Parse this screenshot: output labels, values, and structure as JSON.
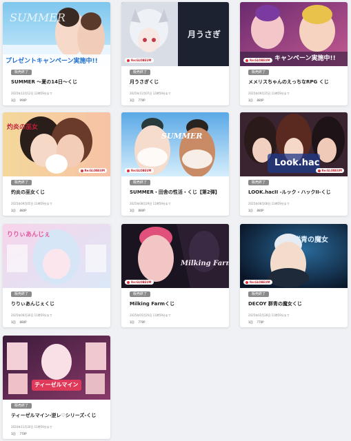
{
  "products": [
    {
      "title": "SUMMER 〜夏の14日〜くじ",
      "status": "販売終了",
      "deadline": "2025年12月12日 12時59分まで",
      "unit": "1回",
      "price": "990P",
      "banner_text": "プレゼントキャンペーン実施中!!"
    },
    {
      "title": "月うさぎくじ",
      "status": "販売終了",
      "deadline": "2025年11月07日 12時59分まで",
      "unit": "1回",
      "price": "770P",
      "banner_text": "月うさぎ"
    },
    {
      "title": "メメリスちゃんのえっちなRPG くじ",
      "status": "販売終了",
      "deadline": "2025年09月25日 11時59分まで",
      "unit": "1回",
      "price": "880P",
      "banner_text": "キャンペーン実施中!!"
    },
    {
      "title": "灼炎の巫女くじ",
      "status": "販売終了",
      "deadline": "2025年09月05日 11時59分まで",
      "unit": "1回",
      "price": "880P",
      "banner_text": "灼炎の巫女"
    },
    {
      "title": "SUMMER・田舎の性活・くじ【第2弾】",
      "status": "販売終了",
      "deadline": "2025年08月29日 11時59分まで",
      "unit": "1回",
      "price": "880P",
      "banner_text": "SUMMER"
    },
    {
      "title": "LOOK.hacII -ルック・ハックII-くじ",
      "status": "販売終了",
      "deadline": "2025年08月08日 11時59分まで",
      "unit": "1回",
      "price": "880P",
      "banner_text": "Look.hac"
    },
    {
      "title": "りりぃあんじぇくじ",
      "status": "販売終了",
      "deadline": "2025年06月30日 11時59分まで",
      "unit": "1回",
      "price": "880P",
      "banner_text": "りりぃあんじぇ"
    },
    {
      "title": "Milking Farmくじ",
      "status": "販売終了",
      "deadline": "2025年05月20日 11時59分まで",
      "unit": "1回",
      "price": "770P",
      "banner_text": "Milking Farm"
    },
    {
      "title": "DECOY 群青の魔女くじ",
      "status": "販売終了",
      "deadline": "2025年02月28日 11時59分まで",
      "unit": "1回",
      "price": "770P",
      "banner_text": "群青の魔女"
    },
    {
      "title": "ティーゼルマイン-逆レ♡シリーズ-くじ",
      "status": "販売終了",
      "deadline": "2024年11月30日 11時59分まで",
      "unit": "1回",
      "price": "770P",
      "banner_text": "ティーゼルマイン"
    }
  ],
  "logo_text": "Re:GLOBEUM",
  "colors": {
    "badge_bg": "#8a8a8a",
    "page_bg": "#f0f1f4",
    "card_bg": "#ffffff"
  }
}
